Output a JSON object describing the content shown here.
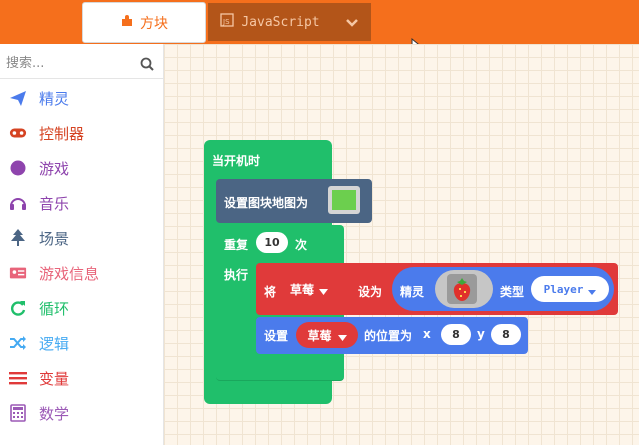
{
  "tabs": {
    "blocks_label": "方块",
    "js_label": "JavaScript"
  },
  "search": {
    "placeholder": "搜索..."
  },
  "categories": [
    {
      "label": "精灵",
      "icon": "paper-plane-icon",
      "color": "#4b7bec"
    },
    {
      "label": "控制器",
      "icon": "gamepad-icon",
      "color": "#d54322"
    },
    {
      "label": "游戏",
      "icon": "circle-icon",
      "color": "#8e44ad"
    },
    {
      "label": "音乐",
      "icon": "headphones-icon",
      "color": "#8e44ad"
    },
    {
      "label": "场景",
      "icon": "tree-icon",
      "color": "#4b6584"
    },
    {
      "label": "游戏信息",
      "icon": "id-card-icon",
      "color": "#e8647a"
    },
    {
      "label": "循环",
      "icon": "refresh-icon",
      "color": "#20bf6b"
    },
    {
      "label": "逻辑",
      "icon": "shuffle-icon",
      "color": "#45aaf2"
    },
    {
      "label": "变量",
      "icon": "list-icon",
      "color": "#e03a3a"
    },
    {
      "label": "数学",
      "icon": "calculator-icon",
      "color": "#9b59b6"
    }
  ],
  "blocks": {
    "on_start": "当开机时",
    "set_tilemap": "设置图块地图为",
    "repeat": "重复",
    "repeat_count": "10",
    "times": "次",
    "do": "执行",
    "set": "将",
    "var_name": "草莓",
    "set_to": "设为",
    "sprite": "精灵",
    "kind": "类型",
    "kind_value": "Player",
    "set2": "设置",
    "var_name2": "草莓",
    "position_to": "的位置为",
    "x_label": "x",
    "x_value": "8",
    "y_label": "y",
    "y_value": "8"
  },
  "colors": {
    "topbar": "#f56f1c",
    "loops": "#20bf6b",
    "scene": "#4b6584",
    "variables": "#e03a3a",
    "sprites": "#4b7bec"
  }
}
